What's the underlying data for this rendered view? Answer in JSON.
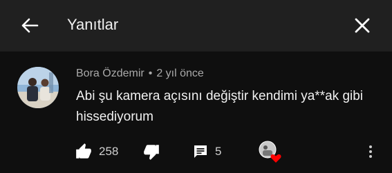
{
  "header": {
    "title": "Yanıtlar"
  },
  "comment": {
    "author": "Bora Özdemir",
    "separator": "•",
    "time": "2 yıl önce",
    "text": "Abi şu kamera açısını değiştir kendimi ya**ak gibi hissediyorum",
    "likes": "258",
    "replies": "5"
  },
  "icons": {
    "back": "arrow-left-icon",
    "close": "close-icon",
    "like": "thumb-up-icon",
    "dislike": "thumb-down-icon",
    "reply": "comment-icon",
    "heart": "creator-heart-icon",
    "more": "more-vertical-icon"
  },
  "colors": {
    "background": "#0f0f0f",
    "header": "#202020",
    "text": "#f1f1f1",
    "muted": "#aaaaaa",
    "heart": "#ff0000"
  }
}
